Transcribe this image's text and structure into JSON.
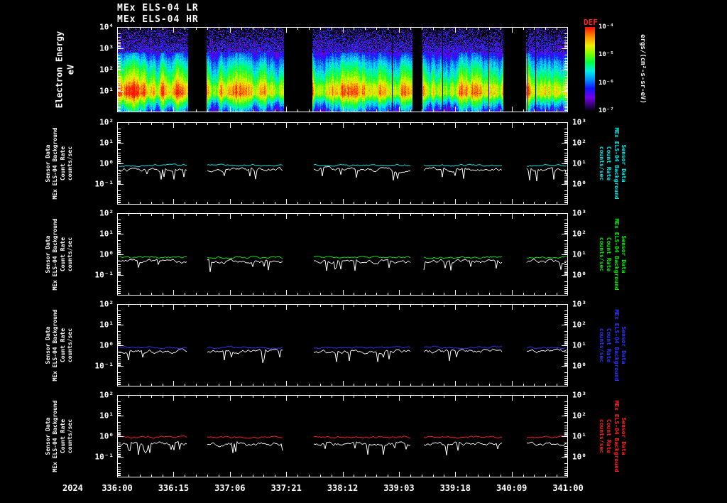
{
  "titles": {
    "lr": "MEx ELS-04 LR",
    "hr": "MEx ELS-04 HR"
  },
  "colorbar": {
    "label": "DEF",
    "label_color": "#ff2020",
    "unit": "ergs/(cm²-s-sr-eV)",
    "ticks": [
      "10⁻⁴",
      "10⁻⁵",
      "10⁻⁶",
      "10⁻⁷"
    ]
  },
  "spectrogram": {
    "ylabel_lines": [
      "Electron Energy",
      "eV"
    ],
    "yticks": [
      "10⁴",
      "10³",
      "10²",
      "10¹"
    ]
  },
  "line_panels": {
    "left_yticks": [
      "10²",
      "10¹",
      "10⁰",
      "10⁻¹"
    ],
    "right_yticks": [
      "10³",
      "10²",
      "10¹",
      "10⁰"
    ],
    "left_label_lines": [
      "Sensor Data",
      "MEx ELS-04 Background",
      "Count Rate",
      "counts/sec"
    ],
    "panels": [
      {
        "id": "panel-cyan",
        "color": "#00e8e8",
        "right_label_lines": [
          "Sensor Data",
          "MEx ELS-04 Background",
          "Count Rate",
          "counts/sec"
        ]
      },
      {
        "id": "panel-green",
        "color": "#00ee00",
        "right_label_lines": [
          "Sensor Data",
          "MEx ELS-04 Background",
          "Count Rate",
          "counts/sec"
        ]
      },
      {
        "id": "panel-blue",
        "color": "#3232ff",
        "right_label_lines": [
          "Sensor Data",
          "MEx ELS-04 Background",
          "Count Rate",
          "counts/sec"
        ]
      },
      {
        "id": "panel-red",
        "color": "#ff2020",
        "right_label_lines": [
          "Sensor Data",
          "MEx ELS-04 Background",
          "Count Rate",
          "counts/sec"
        ]
      }
    ]
  },
  "xaxis": {
    "year": "2024",
    "ticks": [
      "336:00",
      "336:15",
      "337:06",
      "337:21",
      "338:12",
      "339:03",
      "339:18",
      "340:09",
      "341:00"
    ]
  },
  "chart_data": {
    "type": "multi-panel",
    "x": {
      "year": "2024",
      "tick_labels": [
        "336:00",
        "336:15",
        "337:06",
        "337:21",
        "338:12",
        "339:03",
        "339:18",
        "340:09",
        "341:00"
      ],
      "data_segments_frac": [
        [
          0.0,
          0.157
        ],
        [
          0.197,
          0.37
        ],
        [
          0.433,
          0.654
        ],
        [
          0.677,
          0.858
        ],
        [
          0.906,
          1.0
        ]
      ]
    },
    "spectrogram": {
      "type": "heatmap",
      "title": "MEx ELS-04 HR",
      "ylabel": "Electron Energy (eV)",
      "y_range_log_eV": [
        1,
        10000
      ],
      "z_label": "DEF",
      "z_unit": "ergs/(cm²-s-sr-eV)",
      "z_range": [
        1e-07,
        0.0001
      ],
      "flux_vs_energy_profile": {
        "energy_eV": [
          1,
          3,
          10,
          30,
          100,
          300,
          1000,
          3000,
          10000
        ],
        "relative_intensity": [
          0.35,
          0.55,
          0.85,
          0.82,
          0.6,
          0.42,
          0.25,
          0.12,
          0.05
        ]
      }
    },
    "line_charts": [
      {
        "type": "line",
        "panel": "panel-cyan",
        "y_range_left_log": [
          0.01,
          100
        ],
        "y_range_right_log": [
          0.1,
          1000
        ],
        "ylabel": "Sensor Data MEx ELS-04 Background Count Rate counts/sec",
        "series": [
          {
            "name": "background-rate",
            "color": "#00e8e8",
            "mean_counts_per_sec": 0.8
          },
          {
            "name": "count-rate",
            "color": "#ffffff",
            "mean_counts_per_sec": 0.5
          }
        ]
      },
      {
        "type": "line",
        "panel": "panel-green",
        "y_range_left_log": [
          0.01,
          100
        ],
        "y_range_right_log": [
          0.1,
          1000
        ],
        "ylabel": "Sensor Data MEx ELS-04 Background Count Rate counts/sec",
        "series": [
          {
            "name": "background-rate",
            "color": "#00ee00",
            "mean_counts_per_sec": 0.7
          },
          {
            "name": "count-rate",
            "color": "#ffffff",
            "mean_counts_per_sec": 0.45
          }
        ]
      },
      {
        "type": "line",
        "panel": "panel-blue",
        "y_range_left_log": [
          0.01,
          100
        ],
        "y_range_right_log": [
          0.1,
          1000
        ],
        "ylabel": "Sensor Data MEx ELS-04 Background Count Rate counts/sec",
        "series": [
          {
            "name": "background-rate",
            "color": "#3232ff",
            "mean_counts_per_sec": 0.78
          },
          {
            "name": "count-rate",
            "color": "#ffffff",
            "mean_counts_per_sec": 0.5
          }
        ]
      },
      {
        "type": "line",
        "panel": "panel-red",
        "y_range_left_log": [
          0.01,
          100
        ],
        "y_range_right_log": [
          0.1,
          1000
        ],
        "ylabel": "Sensor Data MEx ELS-04 Background Count Rate counts/sec",
        "series": [
          {
            "name": "background-rate",
            "color": "#ff2020",
            "mean_counts_per_sec": 0.9
          },
          {
            "name": "count-rate",
            "color": "#ffffff",
            "mean_counts_per_sec": 0.42
          }
        ]
      }
    ]
  }
}
